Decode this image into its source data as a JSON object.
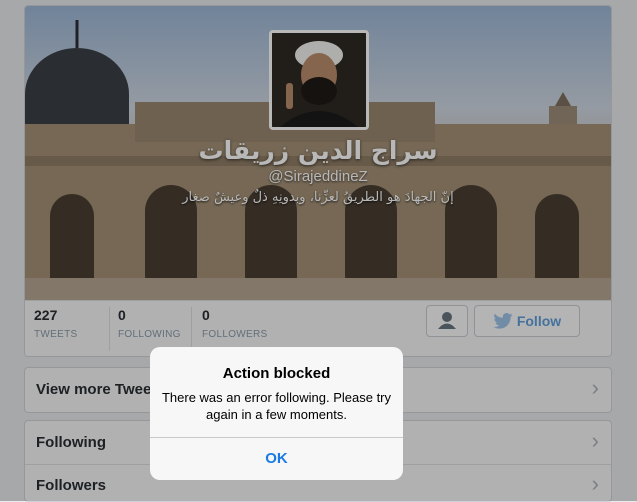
{
  "profile": {
    "name": "سراج الدين زريقات",
    "handle": "@SirajeddineZ",
    "bio": "إنّ الجهادَ هو الطريقُ لعزِّنا، وبدونِهِ ذلٌ وعيشٌ صغار"
  },
  "stats": [
    {
      "value": "227",
      "label": "TWEETS"
    },
    {
      "value": "0",
      "label": "FOLLOWING"
    },
    {
      "value": "0",
      "label": "FOLLOWERS"
    }
  ],
  "actions": {
    "follow_label": "Follow",
    "follow_color": "#5f9ed8"
  },
  "rows": {
    "view_more": "View more Tweets",
    "following": "Following",
    "followers": "Followers"
  },
  "alert": {
    "title": "Action blocked",
    "message": "There was an error following. Please try again in a few moments.",
    "ok_label": "OK",
    "ok_color": "#1a7ae3"
  }
}
